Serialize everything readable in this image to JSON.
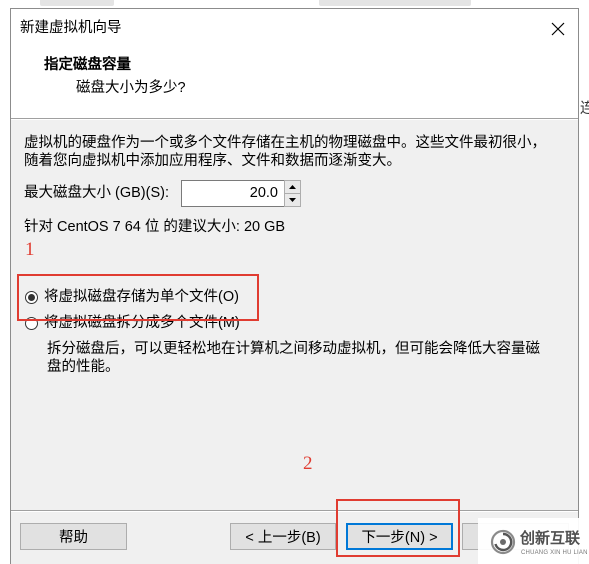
{
  "window": {
    "title": "新建虚拟机向导"
  },
  "header": {
    "title": "指定磁盘容量",
    "subtitle": "磁盘大小为多少?"
  },
  "body": {
    "intro_lines": [
      "虚拟机的硬盘作为一个或多个文件存储在主机的物理磁盘中。这些文件最初很小，",
      "随着您向虚拟机中添加应用程序、文件和数据而逐渐变大。"
    ],
    "max_disk": {
      "label": "最大磁盘大小 (GB)(S):",
      "value": "20.0"
    },
    "recommended": "针对 CentOS 7 64 位 的建议大小: 20 GB",
    "options": [
      {
        "label": "将虚拟磁盘存储为单个文件(O)",
        "selected": true
      },
      {
        "label": "将虚拟磁盘拆分成多个文件(M)",
        "selected": false
      }
    ],
    "split_description_lines": [
      "拆分磁盘后，可以更轻松地在计算机之间移动虚拟机，但可能会降低大容量磁",
      "盘的性能。"
    ]
  },
  "annotations": {
    "marker_1": "1",
    "marker_2": "2"
  },
  "buttons": {
    "help": "帮助",
    "back": "< 上一步(B)",
    "next": "下一步(N) >"
  },
  "watermark": {
    "text": "创新互联",
    "subtext": "CHUANG XIN HU LIAN"
  },
  "background": {
    "partial_text": "连"
  },
  "icons": {
    "close": "close-icon",
    "spin_up": "spinner-up-icon",
    "spin_down": "spinner-down-icon",
    "watermark_logo": "watermark-logo-icon"
  },
  "colors": {
    "annotation": "#e03c31",
    "accent": "#0078d7",
    "panel": "#f0f0f0"
  }
}
